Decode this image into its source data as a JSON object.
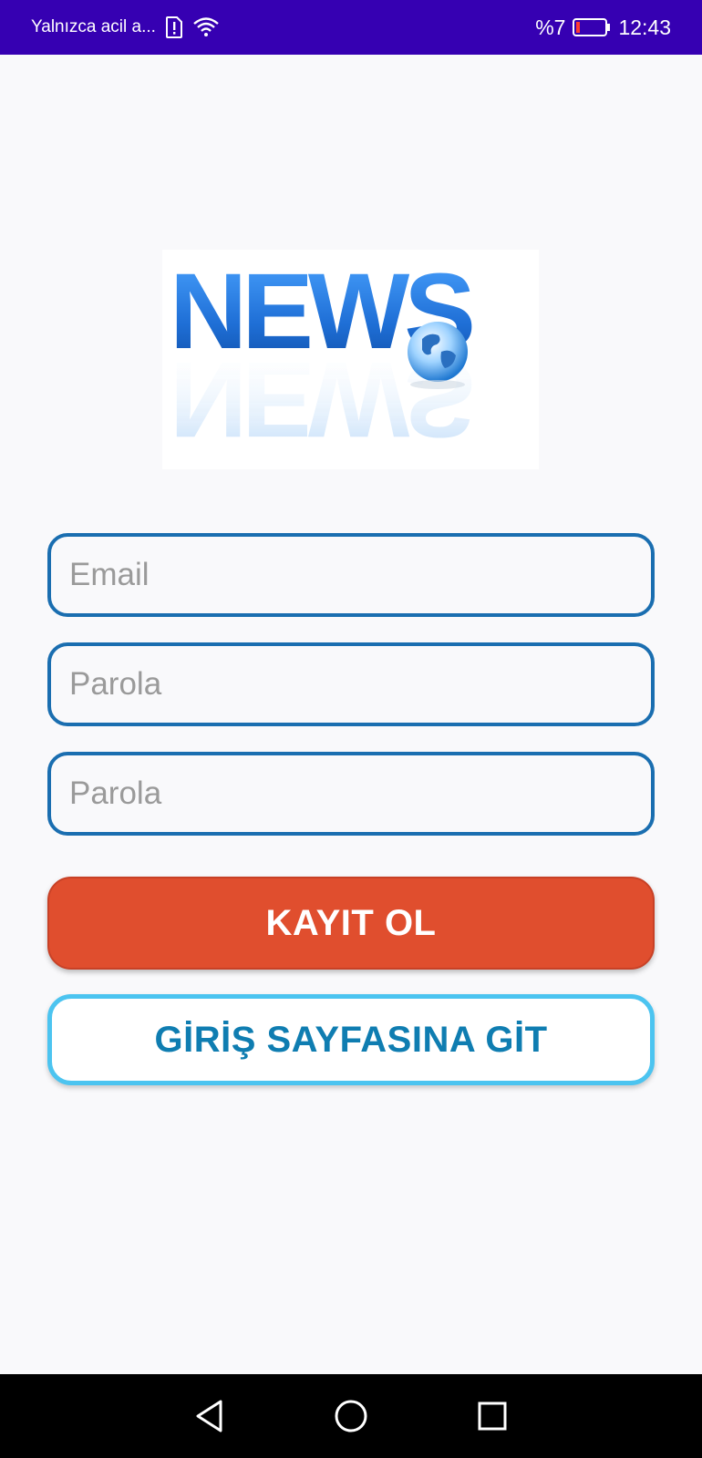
{
  "status_bar": {
    "carrier_text": "Yalnızca acil a...",
    "battery_text": "%7",
    "time": "12:43",
    "background_color": "#3600b2",
    "battery_level_percent": 7
  },
  "logo": {
    "text": "NEWS",
    "icon": "globe-icon",
    "text_color": "#1f6fd6"
  },
  "form": {
    "email_placeholder": "Email",
    "password_placeholder": "Parola",
    "password_confirm_placeholder": "Parola",
    "border_color": "#1a6eb0"
  },
  "buttons": {
    "register_label": "KAYIT OL",
    "register_color": "#e04e2e",
    "login_label": "GİRİŞ SAYFASINA GİT",
    "login_text_color": "#0f7db1",
    "login_border_color": "#4cc4f0"
  },
  "nav_bar": {
    "icons": [
      "back-triangle-icon",
      "home-circle-icon",
      "recents-square-icon"
    ]
  }
}
